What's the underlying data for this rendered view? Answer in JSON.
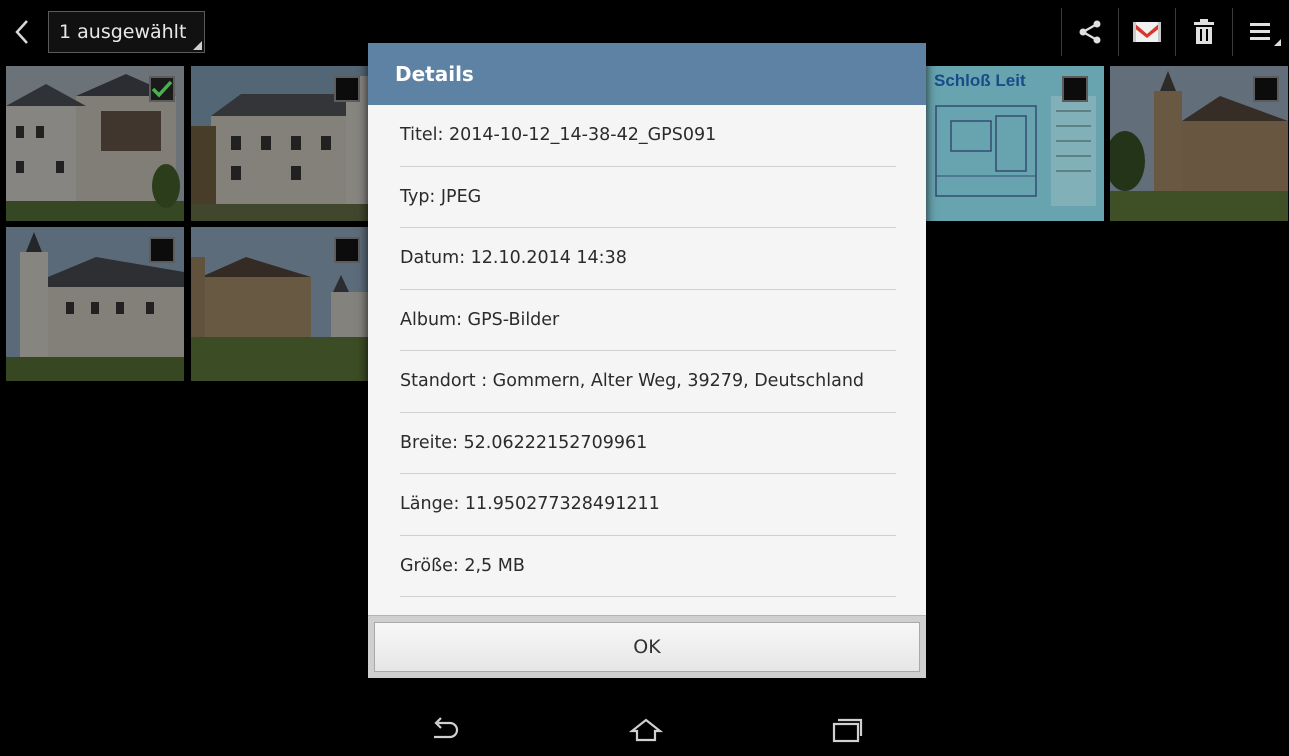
{
  "actionbar": {
    "selection_label": "1 ausgewählt",
    "icons": [
      "back-icon",
      "share-icon",
      "gmail-icon",
      "delete-icon",
      "menu-icon"
    ]
  },
  "gallery": {
    "map_tile_title": "Schloß Leit",
    "tiles": [
      {
        "name": "castle-courtyard",
        "checked": true
      },
      {
        "name": "castle-facade",
        "checked": false
      },
      {
        "name": "site-map",
        "checked": false
      },
      {
        "name": "church",
        "checked": false
      },
      {
        "name": "castle-tower",
        "checked": false
      },
      {
        "name": "church-with-castle",
        "checked": false
      }
    ]
  },
  "dialog": {
    "title": "Details",
    "rows": [
      "Titel: 2014-10-12_14-38-42_GPS091",
      "Typ: JPEG",
      "Datum: 12.10.2014 14:38",
      "Album: GPS-Bilder",
      "Standort : Gommern, Alter Weg, 39279, Deutschland",
      "Breite: 52.06222152709961",
      "Länge: 11.950277328491211",
      "Größe: 2,5 MB"
    ],
    "ok_label": "OK"
  },
  "navbar": {
    "icons": [
      "back-nav-icon",
      "home-icon",
      "recent-apps-icon"
    ]
  },
  "colors": {
    "dialog_header": "#5d82a3",
    "dialog_body": "#f5f5f5",
    "check_green": "#4caf50"
  }
}
